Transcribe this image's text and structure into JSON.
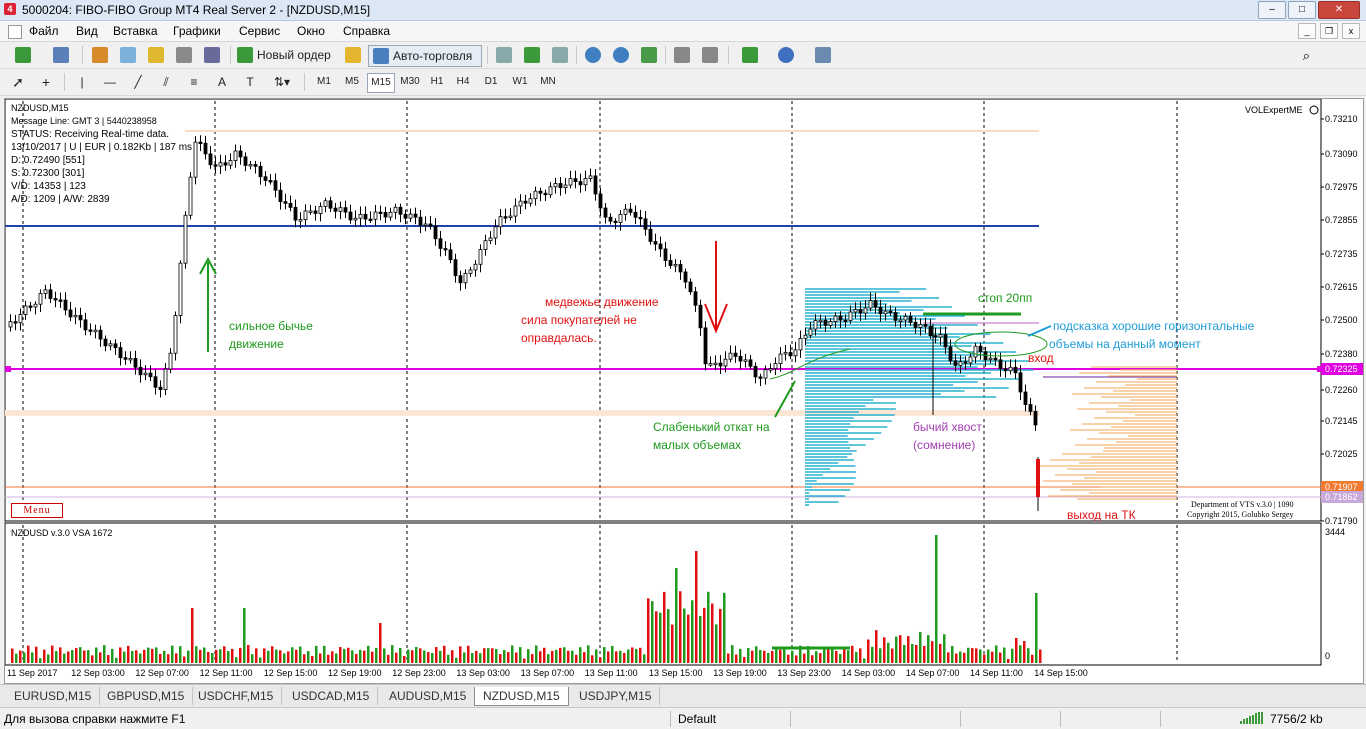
{
  "window": {
    "title": "5000204: FIBO-FIBO Group MT4 Real Server 2 - [NZDUSD,M15]",
    "icon_letter": "4",
    "btn_min": "–",
    "btn_max": "□",
    "btn_close": "✕"
  },
  "menu": {
    "items": [
      "Файл",
      "Вид",
      "Вставка",
      "Графики",
      "Сервис",
      "Окно",
      "Справка"
    ]
  },
  "mdi_buttons": {
    "min": "_",
    "restore": "❐",
    "close": "x"
  },
  "toolbar": {
    "new_order": "Новый ордер",
    "autotrading": "Авто-торговля",
    "help_icon": "magnifier-icon"
  },
  "timeframes": {
    "items": [
      "M1",
      "M5",
      "M15",
      "M30",
      "H1",
      "H4",
      "D1",
      "W1",
      "MN"
    ],
    "active": "M15"
  },
  "chart": {
    "symbol_label": "NZDUSD,M15",
    "info_lines": [
      "Message Line: GMT 3 | 5440238958",
      "STATUS:  Receiving Real-time data.",
      "13/10/2017 | U | EUR | 0.182Kb | 187 ms",
      "D: 0.72490  [551]",
      "S: 0.72300  [301]",
      "V/D: 14353 | 123",
      "A/D: 1209 | A/W: 2839"
    ],
    "indicator_name": "VOLExpertME",
    "menu_button": "Menu",
    "dept_line1": "Department of VTS  v.3.0 | 1090",
    "dept_line2": "Copyright 2015, Golubko Sergey",
    "price_labels": [
      "0.73210",
      "0.73090",
      "0.72975",
      "0.72855",
      "0.72735",
      "0.72615",
      "0.72500",
      "0.72380",
      "0.72260",
      "0.72145",
      "0.72025",
      "0.71790"
    ],
    "current_price": "0.72325",
    "tag_price_1": "0.71907",
    "tag_price_2": "0.71862",
    "time_labels": [
      "11 Sep 2017",
      "12 Sep 03:00",
      "12 Sep 07:00",
      "12 Sep 11:00",
      "12 Sep 15:00",
      "12 Sep 19:00",
      "12 Sep 23:00",
      "13 Sep 03:00",
      "13 Sep 07:00",
      "13 Sep 11:00",
      "13 Sep 15:00",
      "13 Sep 19:00",
      "13 Sep 23:00",
      "14 Sep 03:00",
      "14 Sep 07:00",
      "14 Sep 11:00",
      "14 Sep 15:00"
    ],
    "annotations": {
      "bull_move_1": "сильное бычье",
      "bull_move_2": "движение",
      "bear_move_1": "медвежье движение",
      "bear_move_2": "сила покупателей не",
      "bear_move_3": "оправдалась.",
      "pullback_1": "Слабенький откат на",
      "pullback_2": "малых объемах",
      "stop": "стоп 20пп",
      "hint_1": "подсказка хорошие горизонтальные",
      "hint_2": "объемы на данный момент",
      "entry": "вход",
      "tail_1": "бычий хвост",
      "tail_2": "(сомнение)",
      "exit": "выход  на ТК"
    },
    "volume_panel": {
      "title": "NZDUSD v.3.0 VSA 1672",
      "scale_max": "3444",
      "scale_min": "0"
    },
    "colors": {
      "bull": "#1e9a1e",
      "bear": "#e01010",
      "candle": "#000000",
      "blue_level": "#2244aa",
      "magenta_level": "#e000e0",
      "profile": "#29b3cf",
      "profile_orange": "#f5b67a",
      "annotation_green": "#1e9a1e",
      "annotation_red": "#e01010",
      "annotation_blue": "#1f9bd7",
      "annotation_purple": "#a040b0"
    }
  },
  "tabs": {
    "items": [
      "EURUSD,M15",
      "GBPUSD,M15",
      "USDCHF,M15",
      "USDCAD,M15",
      "AUDUSD,M15",
      "NZDUSD,M15",
      "USDJPY,M15"
    ],
    "active": "NZDUSD,M15"
  },
  "status": {
    "help": "Для вызова справки нажмите F1",
    "profile": "Default",
    "traffic": "7756/2 kb"
  }
}
